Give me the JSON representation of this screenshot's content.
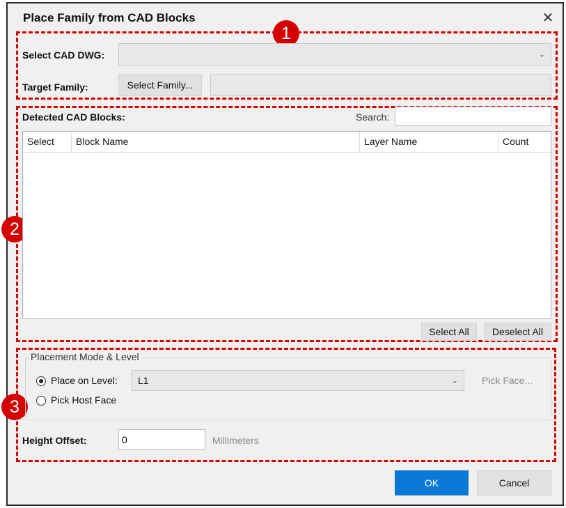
{
  "dialog": {
    "title": "Place Family from CAD Blocks",
    "close_glyph": "✕"
  },
  "section1": {
    "badge": "1",
    "select_cad_label": "Select CAD DWG:",
    "select_cad_value": "",
    "target_family_label": "Target Family:",
    "select_family_button": "Select Family...",
    "target_family_value": ""
  },
  "section2": {
    "badge": "2",
    "detected_label": "Detected CAD Blocks:",
    "search_label": "Search:",
    "search_value": "",
    "columns": [
      "Select",
      "Block Name",
      "Layer Name",
      "Count"
    ],
    "rows": [],
    "select_all_button": "Select All",
    "deselect_all_button": "Deselect All"
  },
  "section3": {
    "badge": "3",
    "group_title": "Placement Mode & Level",
    "place_on_level_label": "Place on Level:",
    "level_value": "L1",
    "pick_face_button": "Pick Face...",
    "pick_host_face_label": "Pick Host Face",
    "height_offset_label": "Height Offset:",
    "height_offset_value": "0",
    "units_label": "Millimeters"
  },
  "footer": {
    "ok_button": "OK",
    "cancel_button": "Cancel"
  },
  "colors": {
    "annotation_red": "#d40000",
    "ok_blue": "#0a78d7",
    "dialog_bg": "#f0f0f0"
  },
  "icons": {
    "close": "close-icon",
    "chevron": "chevron-down-icon"
  }
}
